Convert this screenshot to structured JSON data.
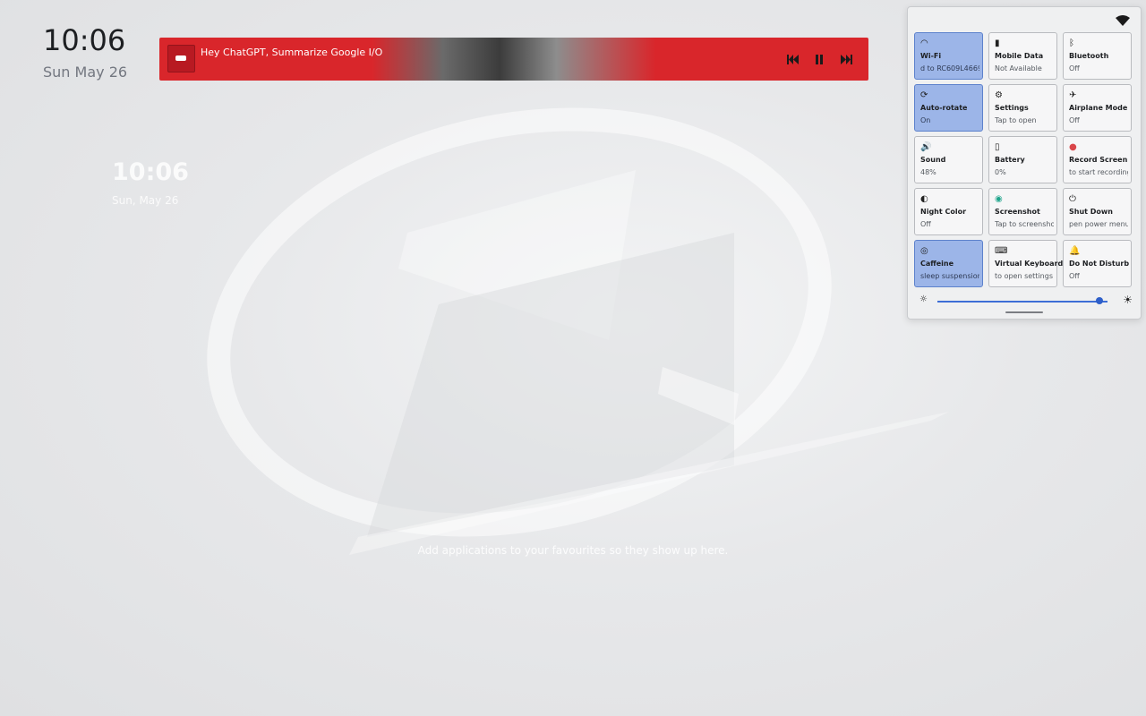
{
  "desktop": {
    "clock_time": "10:06",
    "clock_date": "Sun May 26",
    "widget_time": "10:06",
    "widget_date": "Sun, May 26",
    "favourites_hint": "Add applications to your favourites so they show up here."
  },
  "media": {
    "title": "Hey ChatGPT, Summarize Google I/O",
    "prev_icon": "skip-previous-icon",
    "pause_icon": "pause-icon",
    "next_icon": "skip-next-icon"
  },
  "quick_settings": {
    "tiles": [
      {
        "title": "Wi-Fi",
        "subtitle": "d to RC609L4669 1",
        "icon": "wifi-icon",
        "active": true
      },
      {
        "title": "Mobile Data",
        "subtitle": "Not Available",
        "icon": "signal-icon",
        "active": false
      },
      {
        "title": "Bluetooth",
        "subtitle": "Off",
        "icon": "bluetooth-icon",
        "active": false
      },
      {
        "title": "Auto-rotate",
        "subtitle": "On",
        "icon": "rotate-icon",
        "active": true
      },
      {
        "title": "Settings",
        "subtitle": "Tap to open",
        "icon": "gear-icon",
        "active": false
      },
      {
        "title": "Airplane Mode",
        "subtitle": "Off",
        "icon": "airplane-icon",
        "active": false
      },
      {
        "title": "Sound",
        "subtitle": "48%",
        "icon": "speaker-icon",
        "active": false
      },
      {
        "title": "Battery",
        "subtitle": "0%",
        "icon": "battery-icon",
        "active": false
      },
      {
        "title": "Record Screen",
        "subtitle": "to start recording",
        "icon": "record-icon",
        "active": false
      },
      {
        "title": "Night Color",
        "subtitle": "Off",
        "icon": "moon-icon",
        "active": false
      },
      {
        "title": "Screenshot",
        "subtitle": "Tap to screenshot",
        "icon": "screenshot-icon",
        "active": false
      },
      {
        "title": "Shut Down",
        "subtitle": "pen power menu",
        "icon": "power-icon",
        "active": false
      },
      {
        "title": "Caffeine",
        "subtitle": "sleep suspension",
        "icon": "caffeine-icon",
        "active": true
      },
      {
        "title": "Virtual Keyboard",
        "subtitle": "to open settings",
        "icon": "keyboard-icon",
        "active": false
      },
      {
        "title": "Do Not Disturb",
        "subtitle": "Off",
        "icon": "bell-icon",
        "active": false
      }
    ],
    "brightness": 0.95
  }
}
